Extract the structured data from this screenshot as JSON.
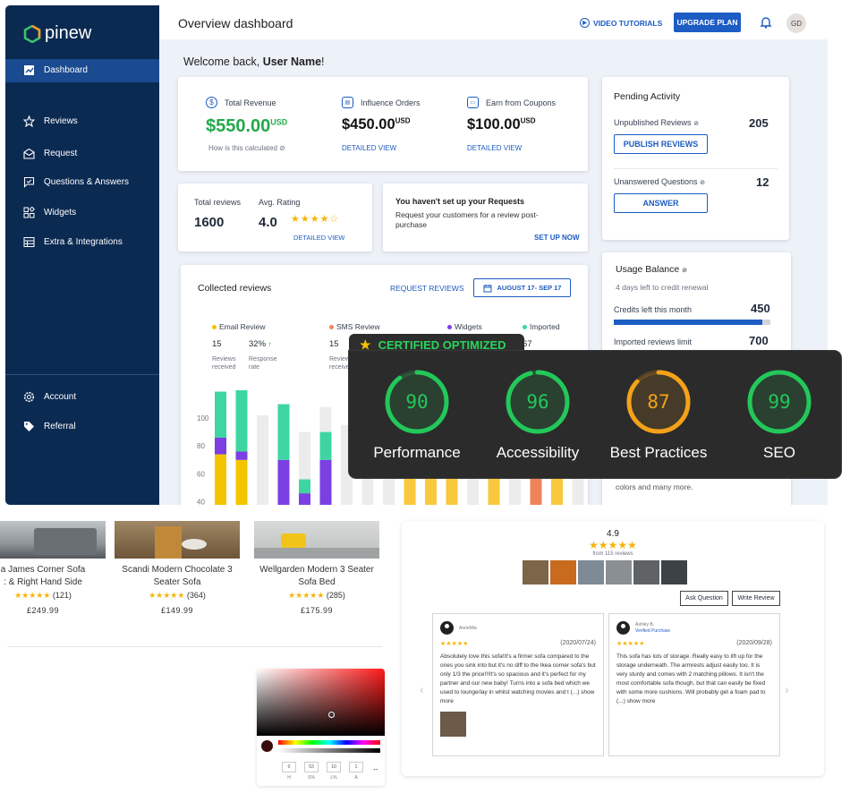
{
  "brand": {
    "name": "pinew"
  },
  "sidebar": {
    "items": [
      {
        "label": "Dashboard"
      },
      {
        "label": "Reviews"
      },
      {
        "label": "Request"
      },
      {
        "label": "Questions & Answers"
      },
      {
        "label": "Widgets"
      },
      {
        "label": "Extra & Integrations"
      },
      {
        "label": "Account"
      },
      {
        "label": "Referral"
      }
    ]
  },
  "header": {
    "title": "Overview dashboard",
    "video_tutorials": "VIDEO TUTORIALS",
    "upgrade": "UPGRADE PLAN",
    "avatar": "GD"
  },
  "welcome": {
    "prefix": "Welcome back, ",
    "name": "User Name",
    "suffix": "!"
  },
  "stats": {
    "revenue": {
      "label": "Total Revenue",
      "value": "$550.00",
      "unit": "USD",
      "note": "How is this calculated"
    },
    "influence": {
      "label": "Influence Orders",
      "value": "$450.00",
      "unit": "USD",
      "link": "DETAILED VIEW"
    },
    "coupons": {
      "label": "Earn from Coupons",
      "value": "$100.00",
      "unit": "USD",
      "link": "DETAILED VIEW"
    }
  },
  "reviews_summary": {
    "total_label": "Total reviews",
    "total": "1600",
    "avg_label": "Avg. Rating",
    "avg": "4.0",
    "link": "DETAILED VIEW",
    "rating_fraction": 0.8
  },
  "requests_setup": {
    "title": "You haven't set up your Requests",
    "desc": "Request your customers for a review post-purchase",
    "link": "SET UP NOW"
  },
  "pending": {
    "title": "Pending Activity",
    "unpub_label": "Unpublished  Reviews",
    "unpub_count": "205",
    "publish_btn": "PUBLISH REVIEWS",
    "unans_label": "Unanswered Questions",
    "unans_count": "12",
    "answer_btn": "ANSWER"
  },
  "usage": {
    "title": "Usage Balance",
    "subtitle": "4 days left to credit renewal",
    "credits_label": "Credits left this month",
    "credits": "450",
    "credits_fraction": 0.95,
    "imported_label": "Imported reviews limit",
    "imported": "700",
    "footer": "colors and many more."
  },
  "collected": {
    "title": "Collected reviews",
    "request_link": "REQUEST REVIEWS",
    "date_range": "AUGUST 17- SEP 17",
    "legend": [
      {
        "name": "Email Review",
        "color": "#f5c400"
      },
      {
        "name": "SMS Review",
        "color": "#f0835a"
      },
      {
        "name": "Widgets",
        "color": "#7b3fe4"
      },
      {
        "name": "Imported",
        "color": "#3dd6a3"
      }
    ],
    "email_count": "15",
    "email_count_label": "Reviews received",
    "email_rate": "32%",
    "email_rate_label": "Response rate",
    "sms_count": "15",
    "sms_count_label": "Reviews receive",
    "imported_partial": "67"
  },
  "chart_data": {
    "type": "bar",
    "ylabel": "",
    "yticks": [
      "100",
      "80",
      "60",
      "40"
    ],
    "ylim": [
      30,
      120
    ],
    "series": [
      {
        "name": "Email Review",
        "values": [
          44,
          40,
          0,
          0,
          0,
          0,
          0,
          0,
          0,
          0,
          0,
          0,
          0,
          0,
          0,
          0,
          0,
          0,
          0
        ]
      },
      {
        "name": "Widgets",
        "values": [
          12,
          6,
          0,
          40,
          16,
          40,
          0,
          0,
          0,
          0,
          0,
          0,
          0,
          0,
          0,
          0,
          0,
          0,
          0
        ]
      },
      {
        "name": "Imported",
        "values": [
          33,
          62,
          0,
          40,
          10,
          20,
          0,
          0,
          0,
          0,
          0,
          0,
          0,
          0,
          0,
          0,
          0,
          0,
          0
        ]
      },
      {
        "name": "Email Review 2",
        "values": [
          0,
          0,
          0,
          0,
          0,
          0,
          0,
          0,
          0,
          40,
          40,
          40,
          0,
          40,
          0,
          0,
          40,
          0,
          0
        ]
      },
      {
        "name": "SMS Review",
        "values": [
          0,
          0,
          0,
          0,
          0,
          0,
          0,
          0,
          0,
          0,
          0,
          0,
          0,
          0,
          0,
          33,
          0,
          0,
          0
        ]
      }
    ],
    "totals": [
      90,
      108,
      102,
      108,
      90,
      108,
      95,
      100,
      100,
      100,
      100,
      100,
      100,
      100,
      100,
      100,
      100,
      100,
      100
    ]
  },
  "lighthouse": {
    "badge": "CERTIFIED OPTIMIZED",
    "scores": [
      {
        "label": "Performance",
        "score": "90",
        "value": 90,
        "color": "#23c85a"
      },
      {
        "label": "Accessibility",
        "score": "96",
        "value": 96,
        "color": "#23c85a"
      },
      {
        "label": "Best Practices",
        "score": "87",
        "value": 87,
        "color": "#f3a21a"
      },
      {
        "label": "SEO",
        "score": "99",
        "value": 99,
        "color": "#23c85a"
      }
    ]
  },
  "products": [
    {
      "name": "a James Corner Sofa",
      "name2": ": & Right Hand Side",
      "rating": "(121)",
      "price": "£249.99"
    },
    {
      "name": "Scandi Modern Chocolate 3",
      "name2": "Seater Sofa",
      "rating": "(364)",
      "price": "£149.99"
    },
    {
      "name": "Wellgarden Modern 3 Seater",
      "name2": "Sofa Bed",
      "rating": "(285)",
      "price": "£175.99"
    }
  ],
  "color_picker": {
    "values": [
      "0",
      "53",
      "10",
      "1"
    ],
    "labels": [
      "H",
      "S%",
      "L%",
      "A"
    ]
  },
  "widget": {
    "avg": "4.9",
    "count": "from 115 reviews",
    "ask": "Ask Question",
    "write": "Write Review",
    "reviews": [
      {
        "author": "AnneMia",
        "date": "(2020/07/24)",
        "text": "Absolutely love this sofa!It's a firmer sofa compared to the ones you sink into but it's no diff to the Ikea corner sofa's but only 1/3 the price!!!It's so spacious and it's perfect for my partner and our new baby! Turns into a sofa bed which we used to lounge/lay in whilst watching movies and t (...) show more"
      },
      {
        "author": "Ashley B.",
        "verified": "Verified Purchase",
        "date": "(2020/09/28)",
        "text": "This sofa has lots of storage. Really easy to lift up for the storage underneath. The armrests adjust easily too. It is very sturdy and comes with 2 matching pillows. It isn't the most comfortable sofa though, but that can easily be fixed with some more cushions. Will probably get a foam pad to (...) show more"
      }
    ]
  }
}
